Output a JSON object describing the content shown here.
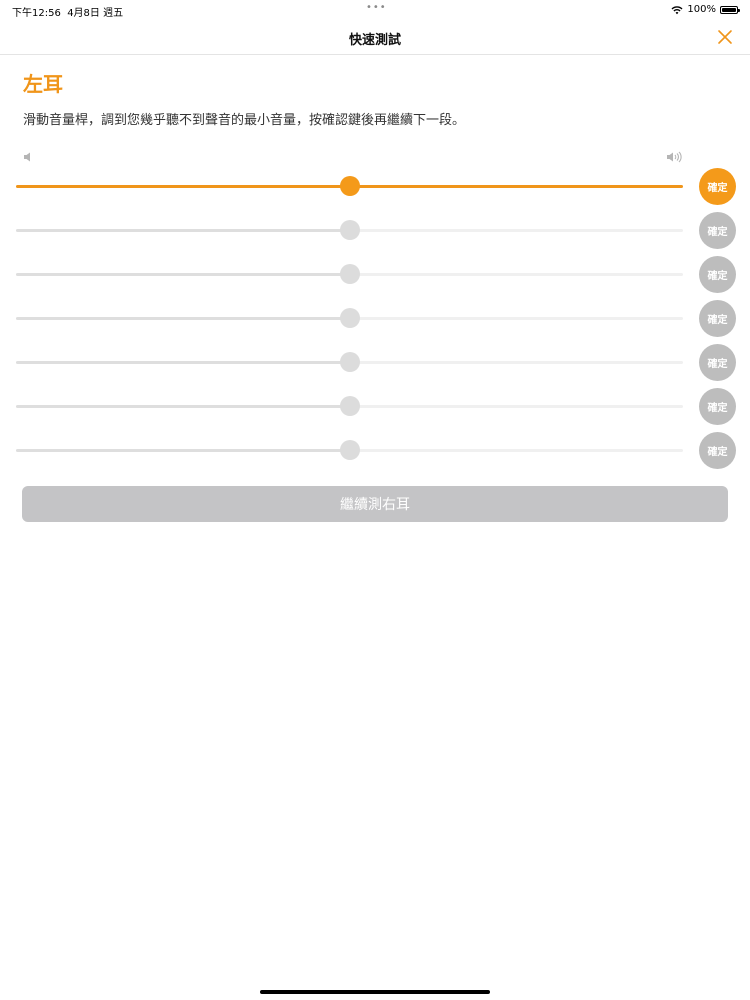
{
  "status_bar": {
    "time": "下午12:56",
    "date": "4月8日 週五",
    "battery": "100%",
    "dots": "•••"
  },
  "nav": {
    "title": "快速測試"
  },
  "section": {
    "title": "左耳",
    "instructions": "滑動音量桿，調到您幾乎聽不到聲音的最小音量，按確認鍵後再繼續下一段。"
  },
  "sliders": [
    {
      "confirm_label": "確定",
      "level": 0.5,
      "active": true
    },
    {
      "confirm_label": "確定",
      "level": 0.5,
      "active": false
    },
    {
      "confirm_label": "確定",
      "level": 0.5,
      "active": false
    },
    {
      "confirm_label": "確定",
      "level": 0.5,
      "active": false
    },
    {
      "confirm_label": "確定",
      "level": 0.5,
      "active": false
    },
    {
      "confirm_label": "確定",
      "level": 0.5,
      "active": false
    },
    {
      "confirm_label": "確定",
      "level": 0.5,
      "active": false
    }
  ],
  "continue_button": {
    "label": "繼續測右耳"
  },
  "colors": {
    "accent": "#f49a1a",
    "inactive_button": "#bdbdbd",
    "disabled_button": "#c4c4c6"
  },
  "icons": {
    "close": "close-icon",
    "volume_low": "volume-low-icon",
    "volume_high": "volume-high-icon",
    "wifi": "wifi-icon",
    "battery": "battery-icon"
  }
}
